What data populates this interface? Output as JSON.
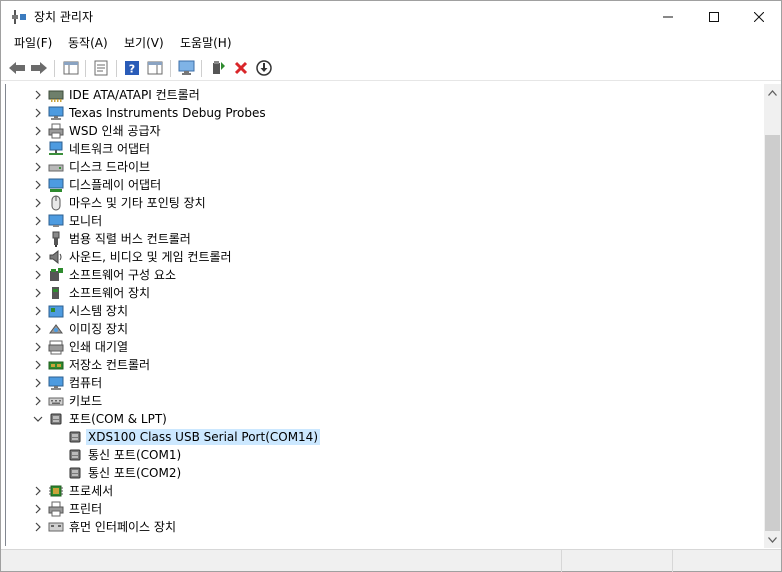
{
  "window": {
    "title": "장치 관리자"
  },
  "controls": {
    "minimize": "—",
    "maximize": "☐",
    "close": "✕"
  },
  "menu": [
    {
      "label": "파일(F)"
    },
    {
      "label": "동작(A)"
    },
    {
      "label": "보기(V)"
    },
    {
      "label": "도움말(H)"
    }
  ],
  "toolbar": [
    {
      "icon": "back-arrow-icon"
    },
    {
      "icon": "forward-arrow-icon"
    },
    {
      "icon": "show-hide-console-tree-icon"
    },
    {
      "icon": "properties-icon"
    },
    {
      "icon": "help-icon"
    },
    {
      "icon": "action-pane-icon"
    },
    {
      "icon": "scan-hardware-icon"
    },
    {
      "icon": "update-driver-icon"
    },
    {
      "icon": "uninstall-icon"
    },
    {
      "icon": "disable-device-icon"
    }
  ],
  "tree": {
    "items": [
      {
        "label": "IDE ATA/ATAPI 컨트롤러",
        "icon": "ide-controller-icon",
        "expanded": false
      },
      {
        "label": "Texas Instruments Debug Probes",
        "icon": "computer-icon",
        "expanded": false
      },
      {
        "label": "WSD 인쇄 공급자",
        "icon": "printer-icon",
        "expanded": false
      },
      {
        "label": "네트워크 어댑터",
        "icon": "network-adapter-icon",
        "expanded": false
      },
      {
        "label": "디스크 드라이브",
        "icon": "disk-drive-icon",
        "expanded": false
      },
      {
        "label": "디스플레이 어댑터",
        "icon": "display-adapter-icon",
        "expanded": false
      },
      {
        "label": "마우스 및 기타 포인팅 장치",
        "icon": "mouse-icon",
        "expanded": false
      },
      {
        "label": "모니터",
        "icon": "monitor-icon",
        "expanded": false
      },
      {
        "label": "범용 직렬 버스 컨트롤러",
        "icon": "usb-icon",
        "expanded": false
      },
      {
        "label": "사운드, 비디오 및 게임 컨트롤러",
        "icon": "speaker-icon",
        "expanded": false
      },
      {
        "label": "소프트웨어 구성 요소",
        "icon": "software-component-icon",
        "expanded": false
      },
      {
        "label": "소프트웨어 장치",
        "icon": "software-device-icon",
        "expanded": false
      },
      {
        "label": "시스템 장치",
        "icon": "system-device-icon",
        "expanded": false
      },
      {
        "label": "이미징 장치",
        "icon": "imaging-device-icon",
        "expanded": false
      },
      {
        "label": "인쇄 대기열",
        "icon": "print-queue-icon",
        "expanded": false
      },
      {
        "label": "저장소 컨트롤러",
        "icon": "storage-controller-icon",
        "expanded": false
      },
      {
        "label": "컴퓨터",
        "icon": "computer-icon",
        "expanded": false
      },
      {
        "label": "키보드",
        "icon": "keyboard-icon",
        "expanded": false
      },
      {
        "label": "포트(COM & LPT)",
        "icon": "port-icon",
        "expanded": true,
        "children": [
          {
            "label": "XDS100 Class USB Serial Port(COM14)",
            "icon": "port-icon",
            "selected": true
          },
          {
            "label": "통신 포트(COM1)",
            "icon": "port-icon",
            "selected": false
          },
          {
            "label": "통신 포트(COM2)",
            "icon": "port-icon",
            "selected": false
          }
        ]
      },
      {
        "label": "프로세서",
        "icon": "processor-icon",
        "expanded": false
      },
      {
        "label": "프린터",
        "icon": "printer-icon",
        "expanded": false
      },
      {
        "label": "휴먼 인터페이스 장치",
        "icon": "hid-icon",
        "expanded": false
      }
    ]
  },
  "colors": {
    "selection": "#cce8ff",
    "accent_green": "#2e8b2e",
    "delete_red": "#d9262a",
    "help_blue": "#2a5cb8"
  }
}
